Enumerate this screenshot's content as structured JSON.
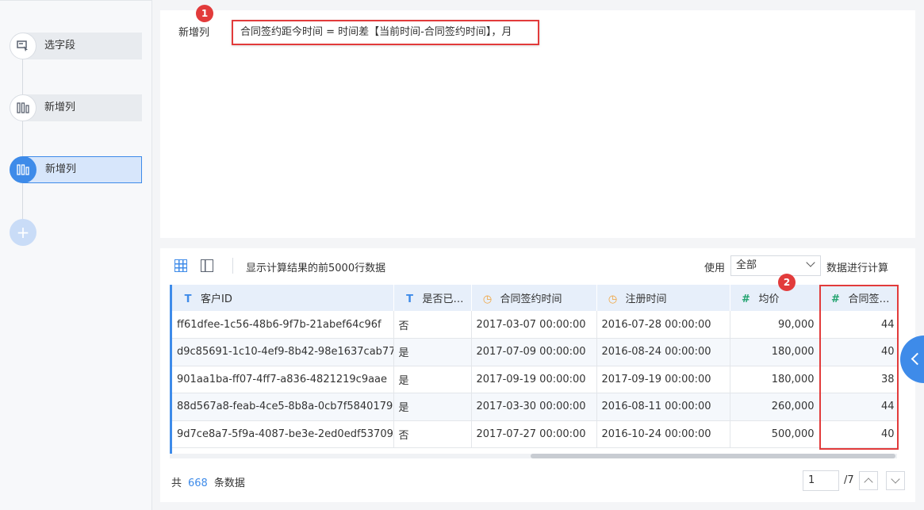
{
  "sidebar": {
    "steps": [
      {
        "label": "选字段",
        "icon": "select-field-icon"
      },
      {
        "label": "新增列",
        "icon": "column-icon"
      },
      {
        "label": "新增列",
        "icon": "column-icon",
        "active": true
      }
    ],
    "add_label": "+"
  },
  "config": {
    "label": "新增列",
    "formula": "合同签约距今时间 = 时间差【当前时间-合同签约时间】，月"
  },
  "annotations": {
    "badge1": "1",
    "badge2": "2"
  },
  "toolbar": {
    "preview_text": "显示计算结果的前5000行数据",
    "use_label": "使用",
    "use_value": "全部",
    "use_suffix": "数据进行计算"
  },
  "table": {
    "columns": [
      {
        "type": "T",
        "label": "客户ID"
      },
      {
        "type": "T",
        "label": "是否已…"
      },
      {
        "type": "clock",
        "label": "合同签约时间"
      },
      {
        "type": "clock",
        "label": "注册时间"
      },
      {
        "type": "#",
        "label": "均价"
      },
      {
        "type": "#",
        "label": "合同签…"
      }
    ],
    "rows": [
      [
        "ff61dfee-1c56-48b6-9f7b-21abef64c96f",
        "否",
        "2017-03-07 00:00:00",
        "2016-07-28 00:00:00",
        "90,000",
        "44"
      ],
      [
        "d9c85691-1c10-4ef9-8b42-98e1637cab77",
        "是",
        "2017-07-09 00:00:00",
        "2016-08-24 00:00:00",
        "180,000",
        "40"
      ],
      [
        "901aa1ba-ff07-4ff7-a836-4821219c9aae",
        "是",
        "2017-09-19 00:00:00",
        "2017-09-19 00:00:00",
        "180,000",
        "38"
      ],
      [
        "88d567a8-feab-4ce5-8b8a-0cb7f5840179",
        "是",
        "2017-03-30 00:00:00",
        "2016-08-11 00:00:00",
        "260,000",
        "44"
      ],
      [
        "9d7ce8a7-5f9a-4087-be3e-2ed0edf53709",
        "否",
        "2017-07-27 00:00:00",
        "2016-10-24 00:00:00",
        "500,000",
        "40"
      ]
    ]
  },
  "footer": {
    "prefix": "共",
    "count": "668",
    "suffix": "条数据",
    "page": "1",
    "total_pages": "/7"
  }
}
